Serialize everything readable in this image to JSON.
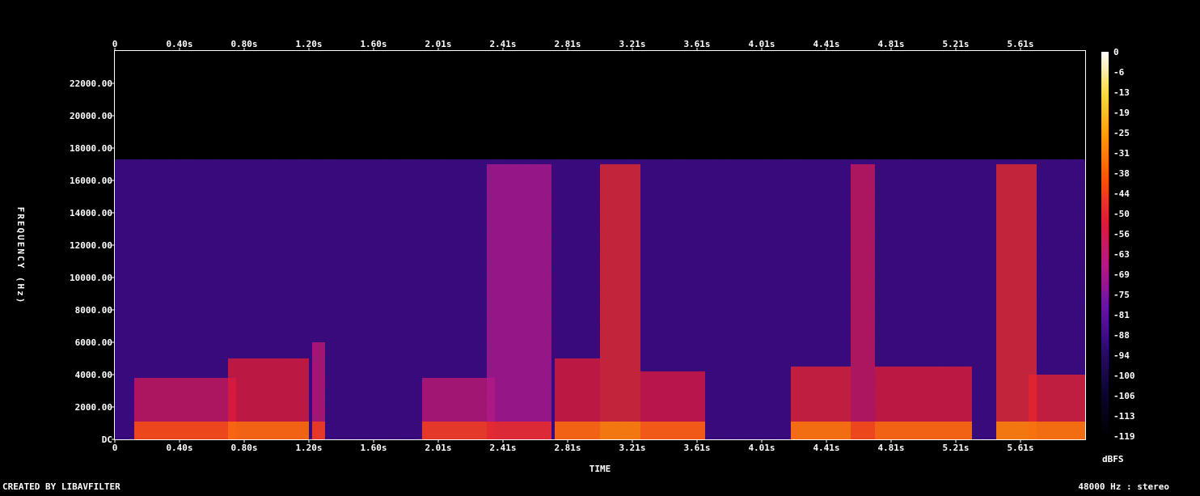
{
  "chart_data": {
    "type": "heatmap",
    "title": "",
    "xlabel": "TIME",
    "ylabel": "FREQUENCY (Hz)",
    "x_ticks": [
      "0",
      "0.40s",
      "0.80s",
      "1.20s",
      "1.60s",
      "2.01s",
      "2.41s",
      "2.81s",
      "3.21s",
      "3.61s",
      "4.01s",
      "4.41s",
      "4.81s",
      "5.21s",
      "5.61s"
    ],
    "y_ticks": [
      "DC",
      "2000.00",
      "4000.00",
      "6000.00",
      "8000.00",
      "10000.00",
      "12000.00",
      "14000.00",
      "16000.00",
      "18000.00",
      "20000.00",
      "22000.00"
    ],
    "xlim": [
      0,
      6.0
    ],
    "ylim": [
      0,
      24000
    ],
    "colorbar": {
      "label": "dBFS",
      "ticks": [
        "0",
        "-6",
        "-13",
        "-19",
        "-25",
        "-31",
        "-38",
        "-44",
        "-50",
        "-56",
        "-63",
        "-69",
        "-75",
        "-81",
        "-88",
        "-94",
        "-100",
        "-106",
        "-113",
        "-119"
      ],
      "range": [
        -119,
        0
      ],
      "colors": [
        "#000000",
        "#0a0530",
        "#2a0a6e",
        "#6a12a0",
        "#b01a8a",
        "#e01838",
        "#f85010",
        "#fc9a08",
        "#f8d840",
        "#ffffff"
      ]
    },
    "lowpass_cutoff_hz": 17300,
    "background_level_db": -90,
    "bursts": [
      {
        "t_start": 0.12,
        "t_end": 0.75,
        "f_max_hz": 3800,
        "level_db": -58
      },
      {
        "t_start": 0.7,
        "t_end": 1.2,
        "f_max_hz": 5000,
        "level_db": -52
      },
      {
        "t_start": 1.22,
        "t_end": 1.3,
        "f_max_hz": 6000,
        "level_db": -62
      },
      {
        "t_start": 1.9,
        "t_end": 2.35,
        "f_max_hz": 3800,
        "level_db": -62
      },
      {
        "t_start": 2.3,
        "t_end": 2.7,
        "f_max_hz": 17000,
        "level_db": -66
      },
      {
        "t_start": 2.72,
        "t_end": 3.0,
        "f_max_hz": 5000,
        "level_db": -52
      },
      {
        "t_start": 3.0,
        "t_end": 3.25,
        "f_max_hz": 17000,
        "level_db": -48
      },
      {
        "t_start": 3.25,
        "t_end": 3.65,
        "f_max_hz": 4200,
        "level_db": -54
      },
      {
        "t_start": 4.18,
        "t_end": 4.55,
        "f_max_hz": 4500,
        "level_db": -50
      },
      {
        "t_start": 4.55,
        "t_end": 4.7,
        "f_max_hz": 17000,
        "level_db": -58
      },
      {
        "t_start": 4.7,
        "t_end": 5.3,
        "f_max_hz": 4500,
        "level_db": -52
      },
      {
        "t_start": 5.45,
        "t_end": 5.7,
        "f_max_hz": 17000,
        "level_db": -48
      },
      {
        "t_start": 5.65,
        "t_end": 6.0,
        "f_max_hz": 4000,
        "level_db": -50
      }
    ]
  },
  "footer": {
    "left": "CREATED BY LIBAVFILTER",
    "right": "48000 Hz : stereo"
  }
}
